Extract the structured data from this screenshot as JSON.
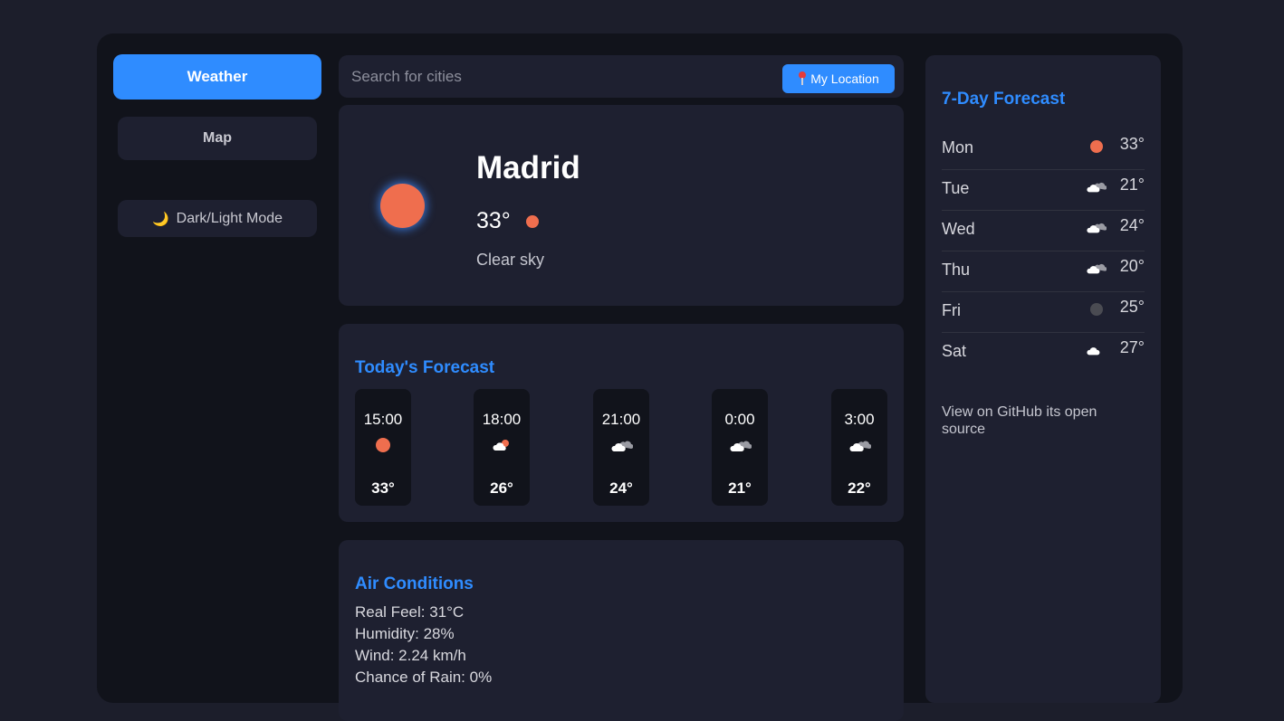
{
  "nav": {
    "weather_label": "Weather",
    "map_label": "Map",
    "mode_label": "Dark/Light Mode",
    "mode_icon": "🌙"
  },
  "search": {
    "placeholder": "Search for cities",
    "value": "",
    "location_button_label": "My Location"
  },
  "current": {
    "city": "Madrid",
    "temp": "33°",
    "description": "Clear sky"
  },
  "today": {
    "title": "Today's Forecast",
    "hours": [
      {
        "time": "15:00",
        "icon": "sun-icon",
        "temp": "33°"
      },
      {
        "time": "18:00",
        "icon": "partly-cloudy-icon",
        "temp": "26°"
      },
      {
        "time": "21:00",
        "icon": "cloud-icon",
        "temp": "24°"
      },
      {
        "time": "0:00",
        "icon": "cloud-icon",
        "temp": "21°"
      },
      {
        "time": "3:00",
        "icon": "cloud-icon",
        "temp": "22°"
      }
    ]
  },
  "air": {
    "title": "Air Conditions",
    "real_feel": "Real Feel: 31°C",
    "humidity": "Humidity: 28%",
    "wind": "Wind: 2.24 km/h",
    "rain": "Chance of Rain: 0%"
  },
  "week": {
    "title": "7-Day Forecast",
    "days": [
      {
        "day": "Mon",
        "icon": "sun-icon",
        "temp": "33°"
      },
      {
        "day": "Tue",
        "icon": "cloud-icon",
        "temp": "21°"
      },
      {
        "day": "Wed",
        "icon": "cloud-icon",
        "temp": "24°"
      },
      {
        "day": "Thu",
        "icon": "cloud-icon",
        "temp": "20°"
      },
      {
        "day": "Fri",
        "icon": "overcast-icon",
        "temp": "25°"
      },
      {
        "day": "Sat",
        "icon": "cloud-icon",
        "temp": "27°"
      }
    ],
    "github_text": "View on GitHub its open source"
  },
  "colors": {
    "accent": "#2f8cff",
    "sun": "#ef6e4e",
    "panel": "#1e2030",
    "background": "#11131b"
  }
}
